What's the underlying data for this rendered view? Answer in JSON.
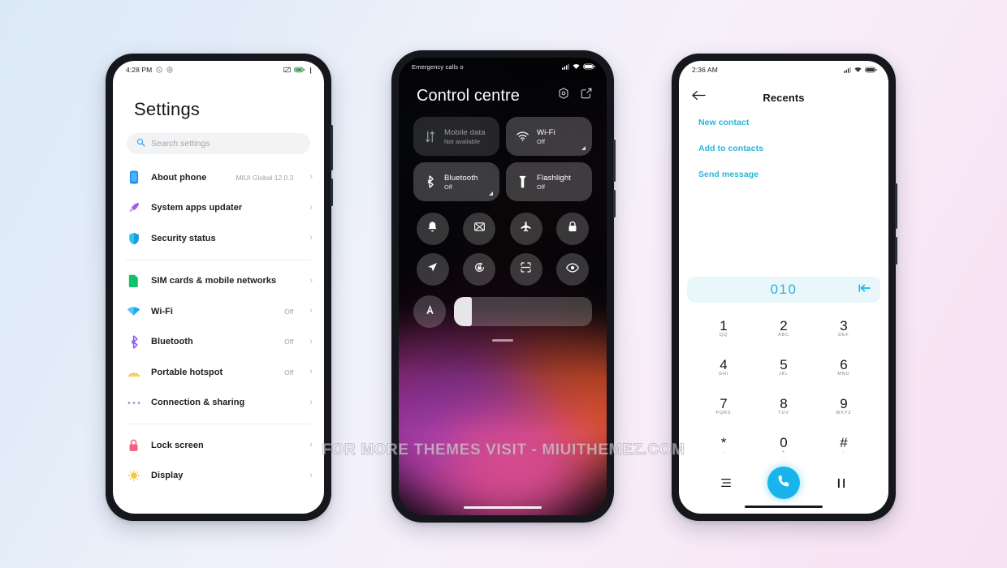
{
  "watermark": "FOR MORE THEMES VISIT - MIUITHEMEZ.COM",
  "background": {
    "from": "#dce9f7",
    "to": "#f6e2f3"
  },
  "phone1": {
    "status": {
      "time": "4:28 PM"
    },
    "title": "Settings",
    "search": {
      "placeholder": "Search settings"
    },
    "groups": [
      {
        "items": [
          {
            "icon": "phone-icon",
            "label": "About phone",
            "value": "MIUI Global 12.0.3"
          },
          {
            "icon": "rocket-icon",
            "label": "System apps updater",
            "value": ""
          },
          {
            "icon": "shield-icon",
            "label": "Security status",
            "value": ""
          }
        ]
      },
      {
        "items": [
          {
            "icon": "sim-card-icon",
            "label": "SIM cards & mobile networks",
            "value": ""
          },
          {
            "icon": "wifi-icon",
            "label": "Wi-Fi",
            "value": "Off"
          },
          {
            "icon": "bluetooth-icon",
            "label": "Bluetooth",
            "value": "Off"
          },
          {
            "icon": "hotspot-icon",
            "label": "Portable hotspot",
            "value": "Off"
          },
          {
            "icon": "dots-icon",
            "label": "Connection & sharing",
            "value": ""
          }
        ]
      },
      {
        "items": [
          {
            "icon": "lock-icon",
            "label": "Lock screen",
            "value": ""
          },
          {
            "icon": "sun-icon",
            "label": "Display",
            "value": ""
          }
        ]
      }
    ]
  },
  "phone2": {
    "status": {
      "carrier": "Emergency calls o"
    },
    "title": "Control centre",
    "header_icons": [
      "settings-hex-icon",
      "edit-square-icon"
    ],
    "tiles": [
      {
        "icon": "data-transfer-icon",
        "name": "Mobile data",
        "sub": "Not available",
        "state": "disabled",
        "expandable": false
      },
      {
        "icon": "wifi-icon",
        "name": "Wi-Fi",
        "sub": "Off",
        "state": "enabled",
        "expandable": true
      },
      {
        "icon": "bluetooth-icon",
        "name": "Bluetooth",
        "sub": "Off",
        "state": "enabled",
        "expandable": true
      },
      {
        "icon": "flashlight-icon",
        "name": "Flashlight",
        "sub": "Off",
        "state": "enabled",
        "expandable": false
      }
    ],
    "toggles": [
      "bell-icon",
      "screenshot-icon",
      "airplane-icon",
      "lock-icon",
      "location-icon",
      "auto-rotate-icon",
      "scan-icon",
      "eye-icon"
    ],
    "brightness": {
      "icon": "auto-brightness-icon",
      "level": 8
    }
  },
  "phone3": {
    "status": {
      "time": "2:36 AM"
    },
    "back_icon": "arrow-left-icon",
    "title": "Recents",
    "actions": [
      "New contact",
      "Add to contacts",
      "Send message"
    ],
    "number": "010",
    "backspace_icon": "backspace-icon",
    "keys": [
      {
        "digit": "1",
        "letters": "QQ"
      },
      {
        "digit": "2",
        "letters": "ABC"
      },
      {
        "digit": "3",
        "letters": "DEF"
      },
      {
        "digit": "4",
        "letters": "GHI"
      },
      {
        "digit": "5",
        "letters": "JKL"
      },
      {
        "digit": "6",
        "letters": "MNO"
      },
      {
        "digit": "7",
        "letters": "PQRS"
      },
      {
        "digit": "8",
        "letters": "TUV"
      },
      {
        "digit": "9",
        "letters": "WXYZ"
      },
      {
        "digit": "*",
        "letters": ","
      },
      {
        "digit": "0",
        "letters": "+"
      },
      {
        "digit": "#",
        "letters": ";"
      }
    ],
    "bottom": {
      "left_icon": "menu-icon",
      "call_icon": "phone-call-icon",
      "right_icon": "pause-icon"
    },
    "accent": "#19b4eb"
  }
}
